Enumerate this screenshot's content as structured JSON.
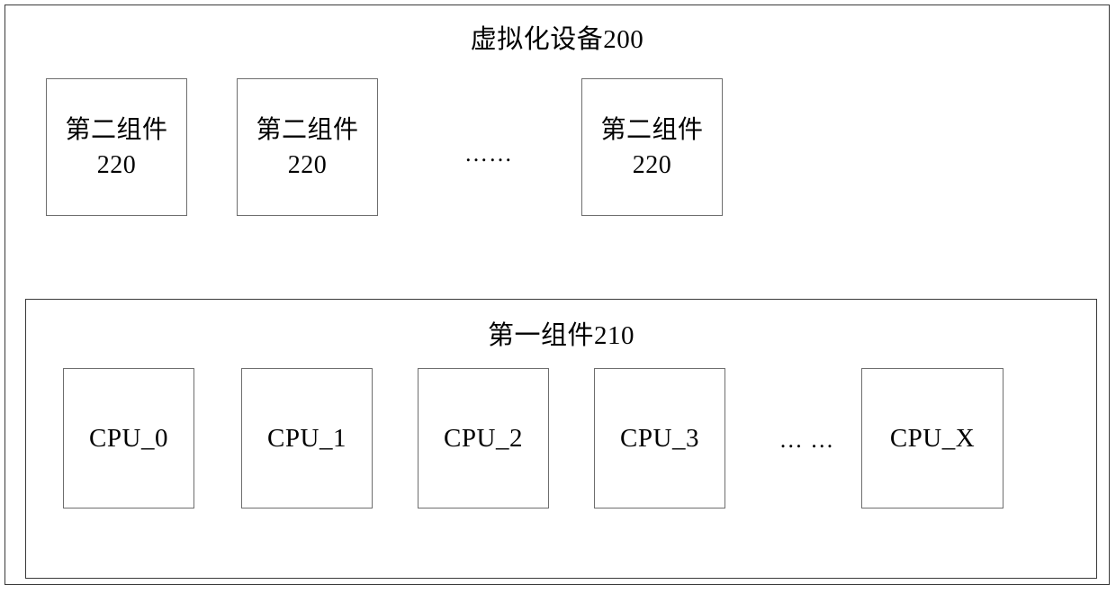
{
  "diagram": {
    "title": "虚拟化设备200",
    "second_component_row": {
      "boxes": [
        {
          "label": "第二组件220"
        },
        {
          "label": "第二组件220"
        },
        {
          "label": "第二组件220"
        }
      ],
      "ellipsis": "……"
    },
    "first_component": {
      "title": "第一组件210",
      "cpu_boxes": [
        {
          "label": "CPU_0"
        },
        {
          "label": "CPU_1"
        },
        {
          "label": "CPU_2"
        },
        {
          "label": "CPU_3"
        },
        {
          "label": "CPU_X"
        }
      ],
      "ellipsis": "… …"
    },
    "colors": {
      "background": "#ffffff",
      "text": "#000000",
      "outer_border": "#3a3a3a",
      "inner_box_border": "#6e6e6e"
    }
  }
}
